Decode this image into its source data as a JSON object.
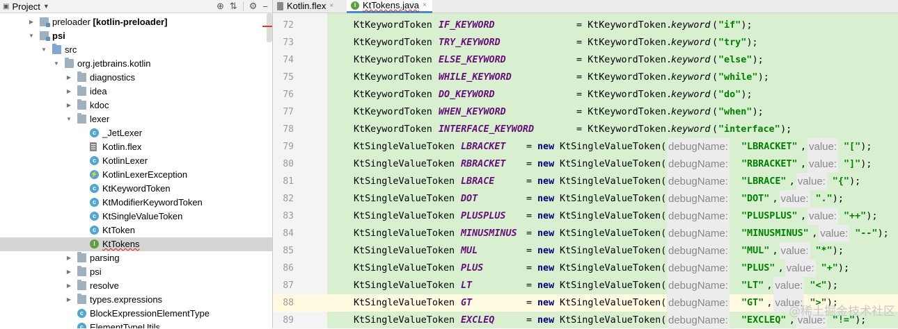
{
  "project_panel": {
    "title": "Project",
    "tree": [
      {
        "label": "preloader",
        "suffix": " [kotlin-preloader]",
        "icon": "module-folder-icon",
        "expanded": false,
        "depth": 0
      },
      {
        "label": "psi",
        "icon": "module-folder-icon",
        "expanded": true,
        "depth": 0,
        "bold": true
      },
      {
        "label": "src",
        "icon": "source-folder-icon",
        "expanded": true,
        "depth": 1
      },
      {
        "label": "org.jetbrains.kotlin",
        "icon": "package-folder-icon",
        "expanded": true,
        "depth": 2
      },
      {
        "label": "diagnostics",
        "icon": "package-folder-icon",
        "expanded": false,
        "depth": 3
      },
      {
        "label": "idea",
        "icon": "package-folder-icon",
        "expanded": false,
        "depth": 3
      },
      {
        "label": "kdoc",
        "icon": "package-folder-icon",
        "expanded": false,
        "depth": 3
      },
      {
        "label": "lexer",
        "icon": "package-folder-icon",
        "expanded": true,
        "depth": 3
      },
      {
        "label": "_JetLexer",
        "icon": "class-icon",
        "depth": 4
      },
      {
        "label": "Kotlin.flex",
        "icon": "flex-file-icon",
        "depth": 4
      },
      {
        "label": "KotlinLexer",
        "icon": "class-icon",
        "depth": 4
      },
      {
        "label": "KotlinLexerException",
        "icon": "exception-class-icon",
        "depth": 4
      },
      {
        "label": "KtKeywordToken",
        "icon": "class-icon",
        "depth": 4
      },
      {
        "label": "KtModifierKeywordToken",
        "icon": "class-icon",
        "depth": 4
      },
      {
        "label": "KtSingleValueToken",
        "icon": "class-icon",
        "depth": 4
      },
      {
        "label": "KtToken",
        "icon": "class-icon",
        "depth": 4
      },
      {
        "label": "KtTokens",
        "icon": "interface-icon",
        "depth": 4,
        "selected": true
      },
      {
        "label": "parsing",
        "icon": "package-folder-icon",
        "expanded": false,
        "depth": 3
      },
      {
        "label": "psi",
        "icon": "package-folder-icon",
        "expanded": false,
        "depth": 3
      },
      {
        "label": "resolve",
        "icon": "package-folder-icon",
        "expanded": false,
        "depth": 3
      },
      {
        "label": "types.expressions",
        "icon": "package-folder-icon",
        "expanded": false,
        "depth": 3
      },
      {
        "label": "BlockExpressionElementType",
        "icon": "class-icon",
        "depth": 3
      },
      {
        "label": "ElementTypeUtils",
        "icon": "class-icon",
        "depth": 3
      }
    ]
  },
  "editor": {
    "tabs": [
      {
        "label": "Kotlin.flex",
        "icon": "flex-file-icon",
        "active": false
      },
      {
        "label": "KtTokens.java",
        "icon": "interface-icon",
        "active": true
      }
    ],
    "current_line": "88",
    "lines": [
      {
        "num": "72",
        "type": "KtKeywordToken",
        "name": "IF_KEYWORD",
        "kind": "keyword",
        "value": "\"if\""
      },
      {
        "num": "73",
        "type": "KtKeywordToken",
        "name": "TRY_KEYWORD",
        "kind": "keyword",
        "value": "\"try\""
      },
      {
        "num": "74",
        "type": "KtKeywordToken",
        "name": "ELSE_KEYWORD",
        "kind": "keyword",
        "value": "\"else\""
      },
      {
        "num": "75",
        "type": "KtKeywordToken",
        "name": "WHILE_KEYWORD",
        "kind": "keyword",
        "value": "\"while\""
      },
      {
        "num": "76",
        "type": "KtKeywordToken",
        "name": "DO_KEYWORD",
        "kind": "keyword",
        "value": "\"do\""
      },
      {
        "num": "77",
        "type": "KtKeywordToken",
        "name": "WHEN_KEYWORD",
        "kind": "keyword",
        "value": "\"when\""
      },
      {
        "num": "78",
        "type": "KtKeywordToken",
        "name": "INTERFACE_KEYWORD",
        "kind": "keyword",
        "value": "\"interface\""
      },
      {
        "num": "79",
        "type": "KtSingleValueToken",
        "name": "LBRACKET",
        "kind": "single",
        "debug": "\"LBRACKET\"",
        "value": "\"[\""
      },
      {
        "num": "80",
        "type": "KtSingleValueToken",
        "name": "RBRACKET",
        "kind": "single",
        "debug": "\"RBRACKET\"",
        "value": "\"]\""
      },
      {
        "num": "81",
        "type": "KtSingleValueToken",
        "name": "LBRACE",
        "kind": "single",
        "debug": "\"LBRACE\"",
        "value": "\"{\""
      },
      {
        "num": "82",
        "type": "KtSingleValueToken",
        "name": "DOT",
        "kind": "single",
        "debug": "\"DOT\"",
        "value": "\".\""
      },
      {
        "num": "83",
        "type": "KtSingleValueToken",
        "name": "PLUSPLUS",
        "kind": "single",
        "debug": "\"PLUSPLUS\"",
        "value": "\"++\""
      },
      {
        "num": "84",
        "type": "KtSingleValueToken",
        "name": "MINUSMINUS",
        "kind": "single",
        "debug": "\"MINUSMINUS\"",
        "value": "\"--\""
      },
      {
        "num": "85",
        "type": "KtSingleValueToken",
        "name": "MUL",
        "kind": "single",
        "debug": "\"MUL\"",
        "value": "\"*\""
      },
      {
        "num": "86",
        "type": "KtSingleValueToken",
        "name": "PLUS",
        "kind": "single",
        "debug": "\"PLUS\"",
        "value": "\"+\""
      },
      {
        "num": "87",
        "type": "KtSingleValueToken",
        "name": "LT",
        "kind": "single",
        "debug": "\"LT\"",
        "value": "\"<\""
      },
      {
        "num": "88",
        "type": "KtSingleValueToken",
        "name": "GT",
        "kind": "single",
        "debug": "\"GT\"",
        "value": "\">\""
      },
      {
        "num": "89",
        "type": "KtSingleValueToken",
        "name": "EXCLEQ",
        "kind": "single",
        "debug": "\"EXCLEQ\"",
        "value": "\"!=\""
      }
    ],
    "keyword_ctor": "= KtKeywordToken.",
    "keyword_fn": "keyword",
    "single_eq": "= ",
    "single_new": "new",
    "single_ctor": " KtSingleValueToken(",
    "hint_debug": "debugName:",
    "hint_value": "value:",
    "colors": {
      "highlight_bg": "#d8f0d0",
      "keyword_purple": "#660e7a",
      "string_green": "#008000",
      "new_navy": "#000080"
    }
  },
  "watermark": "@稀土掘金技术社区"
}
